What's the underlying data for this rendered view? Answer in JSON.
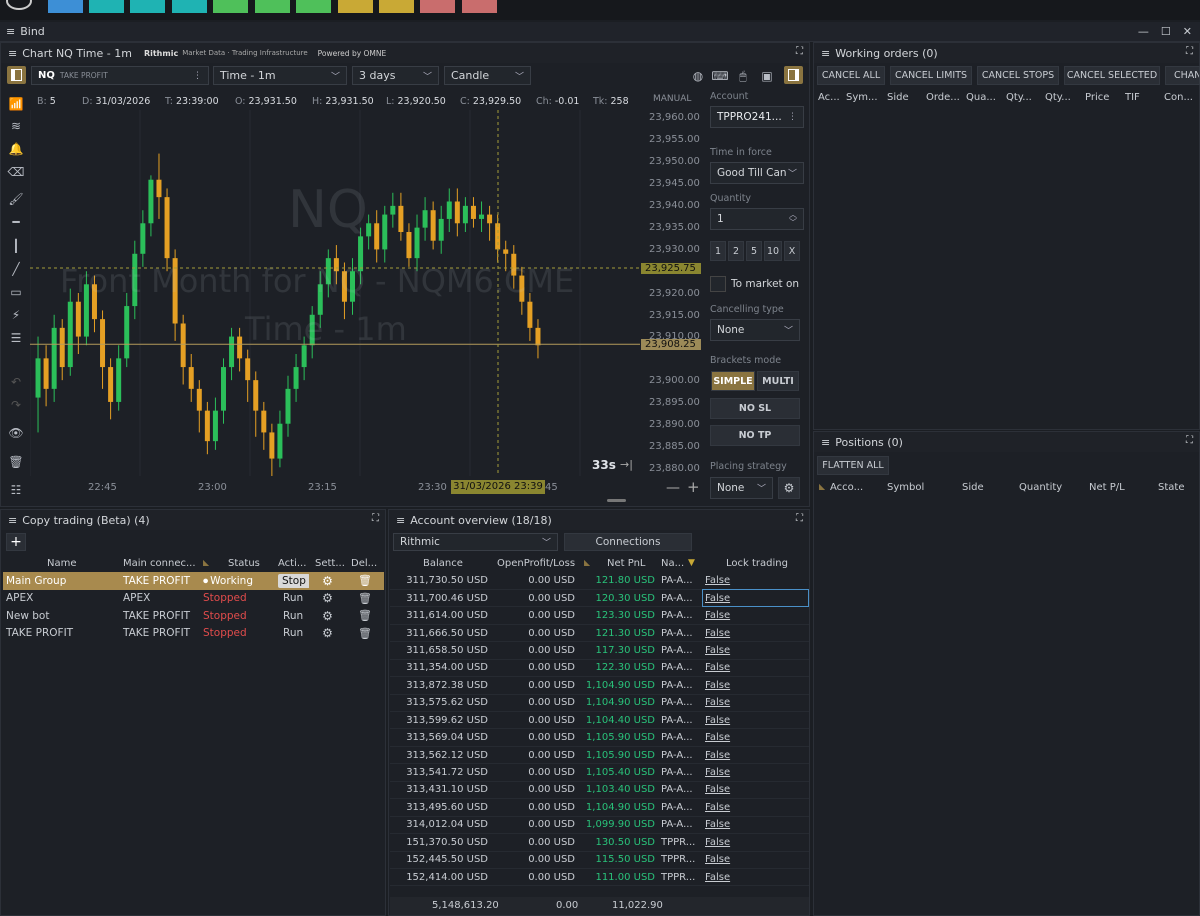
{
  "window": {
    "title": "Bind"
  },
  "colors": {
    "accent": "#8a7440",
    "working_row": "#a88a4e",
    "up_candle": "#2bbf5a",
    "down_candle": "#e5a024",
    "green_text": "#29c27a",
    "red_text": "#e24c4c"
  },
  "chart": {
    "header_title": "Chart NQ Time - 1m",
    "brand_rithmic": "Rithmic",
    "brand_tagline": "Market Data · Trading Infrastructure",
    "brand_omne": "Powered by OMNE",
    "symbol": "NQ",
    "symbol_account": "TAKE PROFIT",
    "timeframe": "Time - 1m",
    "range": "3 days",
    "chart_type": "Candle",
    "mode": "MANUAL",
    "ohlc": {
      "b_label": "B:",
      "b": "5",
      "d_label": "D:",
      "d": "31/03/2026",
      "t_label": "T:",
      "t": "23:39:00",
      "o_label": "O:",
      "o": "23,931.50",
      "h_label": "H:",
      "h": "23,931.50",
      "l_label": "L:",
      "l": "23,920.50",
      "c_label": "C:",
      "c": "23,929.50",
      "ch_label": "Ch:",
      "ch": "-0.01",
      "tk_label": "Tk:",
      "tk": "258"
    },
    "watermark_symbol": "NQ",
    "watermark_desc": "Front Month for NQ - NQM6.CME",
    "watermark_tf": "Time - 1m",
    "price_ticks": [
      "23,960.00",
      "23,955.00",
      "23,950.00",
      "23,945.00",
      "23,940.00",
      "23,935.00",
      "23,930.00",
      "23,925.75",
      "23,920.00",
      "23,915.00",
      "23,910.00",
      "23,908.25",
      "23,900.00",
      "23,895.00",
      "23,890.00",
      "23,885.00",
      "23,880.00"
    ],
    "crosshair_price": "23,925.75",
    "last_price": "23,908.25",
    "time_ticks": [
      "22:45",
      "23:00",
      "23:15",
      "23:30",
      "45"
    ],
    "crosshair_time": "31/03/2026 23:39",
    "countdown": "33s",
    "chart_data": {
      "type": "candlestick",
      "note_visible": "OHLC candles, 1-minute",
      "y_range": [
        23878,
        23962
      ],
      "candles": [
        [
          23896,
          23905,
          23888,
          23910
        ],
        [
          23905,
          23898,
          23894,
          23908
        ],
        [
          23898,
          23912,
          23895,
          23915
        ],
        [
          23912,
          23903,
          23900,
          23914
        ],
        [
          23903,
          23918,
          23901,
          23921
        ],
        [
          23918,
          23910,
          23906,
          23920
        ],
        [
          23910,
          23922,
          23908,
          23925
        ],
        [
          23922,
          23914,
          23911,
          23924
        ],
        [
          23914,
          23903,
          23898,
          23916
        ],
        [
          23903,
          23895,
          23891,
          23905
        ],
        [
          23895,
          23905,
          23893,
          23908
        ],
        [
          23905,
          23917,
          23903,
          23920
        ],
        [
          23917,
          23929,
          23914,
          23932
        ],
        [
          23929,
          23936,
          23926,
          23939
        ],
        [
          23936,
          23946,
          23933,
          23947
        ],
        [
          23946,
          23942,
          23937,
          23952
        ],
        [
          23942,
          23928,
          23925,
          23944
        ],
        [
          23928,
          23913,
          23909,
          23930
        ],
        [
          23913,
          23903,
          23899,
          23915
        ],
        [
          23903,
          23898,
          23895,
          23906
        ],
        [
          23898,
          23893,
          23888,
          23900
        ],
        [
          23893,
          23886,
          23883,
          23895
        ],
        [
          23886,
          23893,
          23884,
          23896
        ],
        [
          23893,
          23903,
          23890,
          23905
        ],
        [
          23903,
          23910,
          23900,
          23912
        ],
        [
          23910,
          23905,
          23902,
          23912
        ],
        [
          23905,
          23900,
          23895,
          23907
        ],
        [
          23900,
          23893,
          23887,
          23902
        ],
        [
          23893,
          23888,
          23884,
          23895
        ],
        [
          23888,
          23882,
          23878,
          23890
        ],
        [
          23882,
          23890,
          23880,
          23893
        ],
        [
          23890,
          23898,
          23887,
          23901
        ],
        [
          23898,
          23903,
          23895,
          23906
        ],
        [
          23903,
          23908,
          23900,
          23910
        ],
        [
          23908,
          23915,
          23905,
          23917
        ],
        [
          23915,
          23922,
          23912,
          23925
        ],
        [
          23922,
          23928,
          23919,
          23930
        ],
        [
          23928,
          23925,
          23922,
          23931
        ],
        [
          23925,
          23918,
          23914,
          23927
        ],
        [
          23918,
          23925,
          23915,
          23928
        ],
        [
          23925,
          23933,
          23922,
          23935
        ],
        [
          23933,
          23936,
          23930,
          23938
        ],
        [
          23936,
          23930,
          23927,
          23939
        ],
        [
          23930,
          23938,
          23927,
          23940
        ],
        [
          23938,
          23940,
          23935,
          23943
        ],
        [
          23940,
          23934,
          23932,
          23943
        ],
        [
          23934,
          23928,
          23926,
          23936
        ],
        [
          23928,
          23935,
          23925,
          23938
        ],
        [
          23935,
          23939,
          23932,
          23942
        ],
        [
          23939,
          23932,
          23930,
          23941
        ],
        [
          23932,
          23937,
          23929,
          23940
        ],
        [
          23937,
          23941,
          23934,
          23944
        ],
        [
          23941,
          23936,
          23933,
          23944
        ],
        [
          23936,
          23940,
          23934,
          23942
        ],
        [
          23940,
          23937,
          23935,
          23942
        ],
        [
          23937,
          23938,
          23934,
          23941
        ],
        [
          23938,
          23936,
          23932,
          23940
        ],
        [
          23936,
          23930,
          23927,
          23938
        ],
        [
          23930,
          23929,
          23925,
          23932
        ],
        [
          23929,
          23924,
          23921,
          23931
        ],
        [
          23924,
          23918,
          23915,
          23926
        ],
        [
          23918,
          23912,
          23909,
          23920
        ],
        [
          23912,
          23908,
          23905,
          23914
        ]
      ]
    }
  },
  "order_entry": {
    "account_label": "Account",
    "account": "TPPRO241...",
    "tif_label": "Time in force",
    "tif": "Good Till Can",
    "qty_label": "Quantity",
    "qty": "1",
    "qty_presets": [
      "1",
      "2",
      "5",
      "10",
      "X"
    ],
    "to_market": "To market on",
    "cancel_type_label": "Cancelling type",
    "cancel_type": "None",
    "brackets_label": "Brackets mode",
    "simple": "SIMPLE",
    "multi": "MULTI",
    "no_sl": "NO SL",
    "no_tp": "NO TP",
    "strategy_label": "Placing strategy",
    "strategy": "None"
  },
  "working_orders": {
    "title": "Working orders (0)",
    "buttons": [
      "CANCEL ALL",
      "CANCEL LIMITS",
      "CANCEL STOPS",
      "CANCEL SELECTED",
      "CHAN"
    ],
    "columns": [
      "Ac...",
      "Sym...",
      "Side",
      "Orde...",
      "Qua...",
      "Qty...",
      "Qty...",
      "Price",
      "TIF",
      "Con..."
    ]
  },
  "positions": {
    "title": "Positions (0)",
    "flatten": "FLATTEN ALL",
    "columns": [
      "Acco...",
      "Symbol",
      "Side",
      "Quantity",
      "Net P/L",
      "State"
    ]
  },
  "copy_trading": {
    "title": "Copy trading (Beta) (4)",
    "columns": [
      "Name",
      "Main connec...",
      "Status",
      "Acti...",
      "Sett...",
      "Del..."
    ],
    "rows": [
      {
        "name": "Main Group",
        "conn": "TAKE PROFIT",
        "status": "Working",
        "action": "Stop"
      },
      {
        "name": "APEX",
        "conn": "APEX",
        "status": "Stopped",
        "action": "Run"
      },
      {
        "name": "New bot",
        "conn": "TAKE PROFIT",
        "status": "Stopped",
        "action": "Run"
      },
      {
        "name": "TAKE PROFIT",
        "conn": "TAKE PROFIT",
        "status": "Stopped",
        "action": "Run"
      }
    ]
  },
  "account_overview": {
    "title": "Account overview (18/18)",
    "connection": "Rithmic",
    "connections_btn": "Connections",
    "columns": [
      "Balance",
      "OpenProfit/Loss",
      "Net PnL",
      "Na...",
      "Lock trading"
    ],
    "rows": [
      [
        "311,730.50 USD",
        "0.00 USD",
        "121.80 USD",
        "PA-A...",
        "False"
      ],
      [
        "311,700.46 USD",
        "0.00 USD",
        "120.30 USD",
        "PA-A...",
        "False"
      ],
      [
        "311,614.00 USD",
        "0.00 USD",
        "123.30 USD",
        "PA-A...",
        "False"
      ],
      [
        "311,666.50 USD",
        "0.00 USD",
        "121.30 USD",
        "PA-A...",
        "False"
      ],
      [
        "311,658.50 USD",
        "0.00 USD",
        "117.30 USD",
        "PA-A...",
        "False"
      ],
      [
        "311,354.00 USD",
        "0.00 USD",
        "122.30 USD",
        "PA-A...",
        "False"
      ],
      [
        "313,872.38 USD",
        "0.00 USD",
        "1,104.90 USD",
        "PA-A...",
        "False"
      ],
      [
        "313,575.62 USD",
        "0.00 USD",
        "1,104.90 USD",
        "PA-A...",
        "False"
      ],
      [
        "313,599.62 USD",
        "0.00 USD",
        "1,104.40 USD",
        "PA-A...",
        "False"
      ],
      [
        "313,569.04 USD",
        "0.00 USD",
        "1,105.90 USD",
        "PA-A...",
        "False"
      ],
      [
        "313,562.12 USD",
        "0.00 USD",
        "1,105.90 USD",
        "PA-A...",
        "False"
      ],
      [
        "313,541.72 USD",
        "0.00 USD",
        "1,105.40 USD",
        "PA-A...",
        "False"
      ],
      [
        "313,431.10 USD",
        "0.00 USD",
        "1,103.40 USD",
        "PA-A...",
        "False"
      ],
      [
        "313,495.60 USD",
        "0.00 USD",
        "1,104.90 USD",
        "PA-A...",
        "False"
      ],
      [
        "314,012.04 USD",
        "0.00 USD",
        "1,099.90 USD",
        "PA-A...",
        "False"
      ],
      [
        "151,370.50 USD",
        "0.00 USD",
        "130.50 USD",
        "TPPR...",
        "False"
      ],
      [
        "152,445.50 USD",
        "0.00 USD",
        "115.50 USD",
        "TPPR...",
        "False"
      ],
      [
        "152,414.00 USD",
        "0.00 USD",
        "111.00 USD",
        "TPPR...",
        "False"
      ]
    ],
    "totals": {
      "balance": "5,148,613.20",
      "open": "0.00",
      "net": "11,022.90"
    }
  }
}
